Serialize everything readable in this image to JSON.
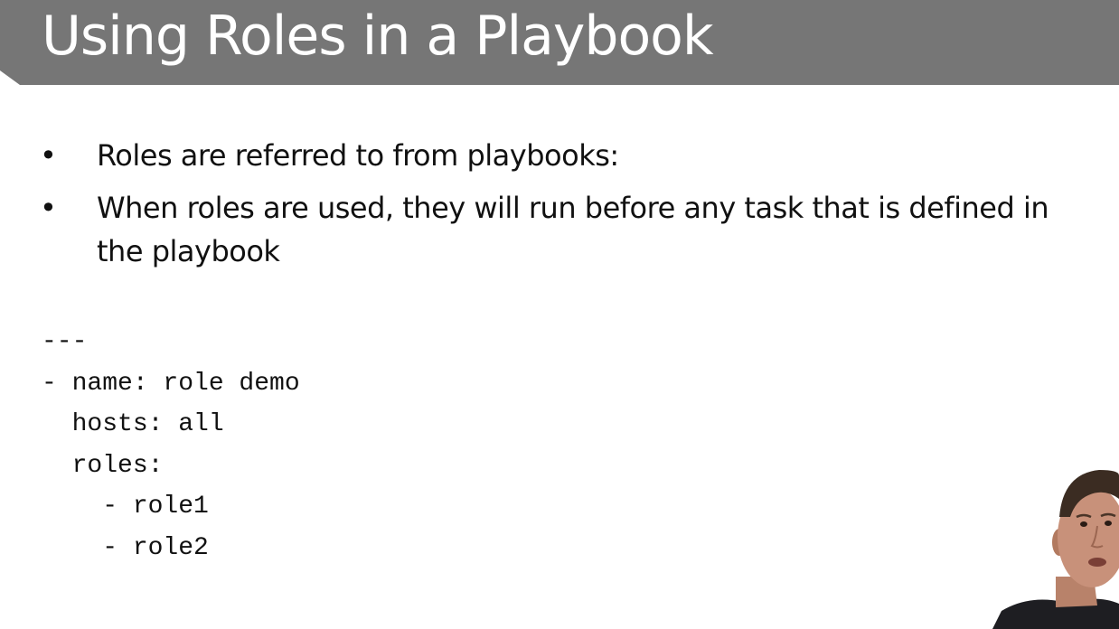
{
  "slide": {
    "title": "Using Roles in a Playbook",
    "bullets": [
      {
        "marker": "•",
        "text": "Roles are referred to from playbooks:"
      },
      {
        "marker": "•",
        "text": "When roles are used, they will run before any task that is defined in the playbook"
      }
    ],
    "code_lines": [
      "---",
      "- name: role demo",
      "  hosts: all",
      "  roles:",
      "    - role1",
      "    - role2"
    ]
  },
  "colors": {
    "title_bar": "#767676",
    "title_text": "#ffffff",
    "body_text": "#111111",
    "background": "#ffffff"
  },
  "presenter": {
    "icon": "presenter-video-thumbnail"
  }
}
